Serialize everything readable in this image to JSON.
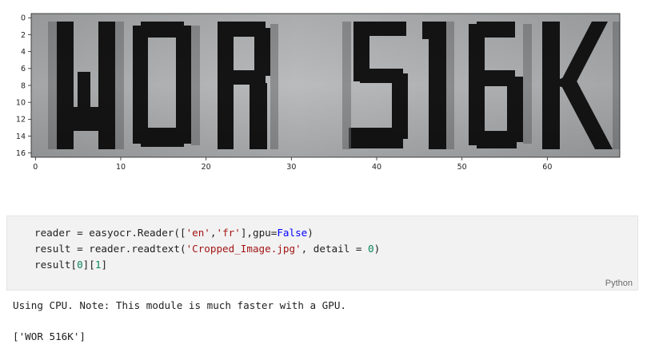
{
  "figure": {
    "chart_data": {
      "type": "image",
      "image_text": "WOR 516K",
      "x_ticks": [
        "0",
        "10",
        "20",
        "30",
        "40",
        "50",
        "60"
      ],
      "y_ticks": [
        "0",
        "2",
        "4",
        "6",
        "8",
        "10",
        "12",
        "14",
        "16"
      ],
      "xlim": [
        0,
        69
      ],
      "ylim": [
        0,
        17
      ]
    }
  },
  "code_cell": {
    "line1_prefix": "reader = easyocr.Reader([",
    "line1_str1": "'en'",
    "line1_comma": ",",
    "line1_str2": "'fr'",
    "line1_mid": "],gpu=",
    "line1_kw": "False",
    "line1_end": ")",
    "line2_prefix": "result = reader.readtext(",
    "line2_str": "'Cropped_Image.jpg'",
    "line2_mid": ", detail = ",
    "line2_num": "0",
    "line2_end": ")",
    "line3_prefix": "result[",
    "line3_num1": "0",
    "line3_mid": "][",
    "line3_num2": "1",
    "line3_end": "]",
    "language": "Python"
  },
  "output": {
    "line1": "Using CPU. Note: This module is much faster with a GPU.",
    "line2": "['WOR 516K']"
  },
  "colors": {
    "string": "#a31515",
    "keyword": "#0000ff",
    "number": "#098658",
    "cell_background": "#f2f2f2"
  }
}
